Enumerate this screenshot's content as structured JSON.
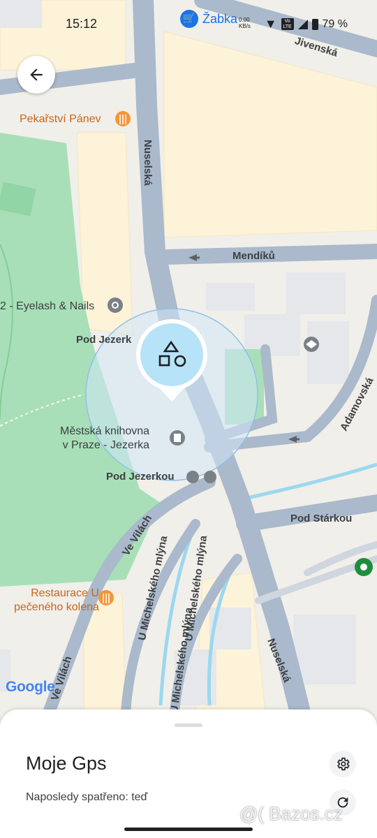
{
  "status_bar": {
    "time": "15:12",
    "notification_label": "Žabka",
    "network_speed": "0.00 KB/s",
    "lte_label": "Vo LTE",
    "battery": "79 %"
  },
  "map": {
    "streets": {
      "jivenska": "Jivenská",
      "nuselska_top": "Nuselská",
      "mendiku": "Mendíků",
      "adamovska": "Adamovská",
      "pod_starkou": "Pod Stárkou",
      "ve_vilach_1": "Ve Vilách",
      "ve_vilach_2": "Ve Vilách",
      "u_michelskeho_1": "U Michelského mlýna",
      "u_michelskeho_2": "U Michelského mlýna",
      "u_michelskeho_3": "U Michelského mlýna",
      "nuselska_bottom": "Nuselská"
    },
    "pois": {
      "pekarstvi": "Pekařství Pánev",
      "eyelash": "2 - Eyelash & Nails",
      "pod_jezerk": "Pod Jezerk",
      "knihovna_line1": "Městská knihovna",
      "knihovna_line2": "v Praze - Jezerka",
      "pod_jezerkou": "Pod Jezerkou",
      "restaurace_line1": "Restaurace U",
      "restaurace_line2": "pečeného kolena"
    },
    "attribution": "Google",
    "colors": {
      "park": "#a8dfb8",
      "road": "#aab9cb",
      "building": "#fdf3d9",
      "water": "#9bd8f0",
      "accuracy": "#cfe5f7",
      "marker": "#b7e3f8"
    }
  },
  "device": {
    "name": "Moje Gps",
    "last_seen": "Naposledy spatřeno: teď"
  },
  "icons": {
    "back": "arrow-left-icon",
    "settings": "gear-icon",
    "refresh": "refresh-icon",
    "device": "shapes-icon"
  },
  "watermark": "@( Bazos.cz"
}
